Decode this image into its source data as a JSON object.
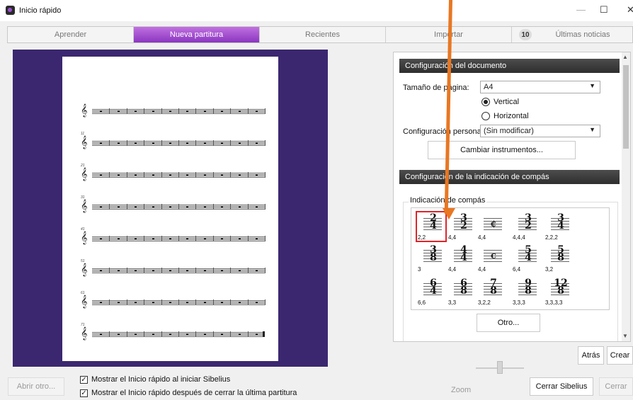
{
  "window": {
    "title": "Inicio rápido",
    "min": "—",
    "max": "☐",
    "close": "✕"
  },
  "tabs": [
    {
      "label": "Aprender"
    },
    {
      "label": "Nueva partitura"
    },
    {
      "label": "Recientes"
    },
    {
      "label": "Importar"
    },
    {
      "label": "Últimas noticias",
      "badge": "10"
    }
  ],
  "preview": {
    "measure_numbers": [
      "",
      "11",
      "21",
      "31",
      "41",
      "51",
      "61",
      "71"
    ]
  },
  "doc_config": {
    "header": "Configuración del documento",
    "page_size_label": "Tamaño de página:",
    "page_size_value": "A4",
    "orientation_vertical": "Vertical",
    "orientation_horizontal": "Horizontal",
    "orientation_selected": "Vertical",
    "custom_label": "Configuración personal",
    "custom_value": "(Sin modificar)",
    "change_instruments": "Cambiar instrumentos..."
  },
  "time_sig": {
    "header": "Configuración de la indicación de compás",
    "group_label": "Indicación de compás",
    "items": [
      {
        "top": "2",
        "bottom": "4",
        "grouping": "2,2",
        "selected": true
      },
      {
        "top": "3",
        "bottom": "2",
        "grouping": "4,4"
      },
      {
        "symbol": "¢",
        "grouping": "4,4"
      },
      {
        "top": "3",
        "bottom": "2",
        "grouping": "4,4,4"
      },
      {
        "top": "3",
        "bottom": "4",
        "grouping": "2,2,2"
      },
      {
        "top": "3",
        "bottom": "8",
        "grouping": "3"
      },
      {
        "top": "4",
        "bottom": "4",
        "grouping": "4,4"
      },
      {
        "symbol": "c",
        "grouping": "4,4"
      },
      {
        "top": "5",
        "bottom": "4",
        "grouping": "6,4"
      },
      {
        "top": "5",
        "bottom": "8",
        "grouping": "3,2"
      },
      {
        "top": "6",
        "bottom": "4",
        "grouping": "6,6"
      },
      {
        "top": "6",
        "bottom": "8",
        "grouping": "3,3"
      },
      {
        "top": "7",
        "bottom": "8",
        "grouping": "3,2,2"
      },
      {
        "top": "9",
        "bottom": "8",
        "grouping": "3,3,3"
      },
      {
        "top": "12",
        "bottom": "8",
        "grouping": "3,3,3,3"
      }
    ],
    "other_button": "Otro..."
  },
  "nav": {
    "back": "Atrás",
    "create": "Crear"
  },
  "footer": {
    "open_other": "Abrir otro...",
    "show_on_start": "Mostrar el Inicio rápido al iniciar Sibelius",
    "show_after_close": "Mostrar el Inicio rápido después de cerrar la última partitura",
    "zoom_label": "Zoom",
    "close_sibelius": "Cerrar Sibelius",
    "cancel": "Cerrar"
  },
  "colors": {
    "accent": "#9a44d0",
    "preview_bg": "#3b2770",
    "annotation_arrow": "#e87722",
    "selection": "#e0242a"
  }
}
